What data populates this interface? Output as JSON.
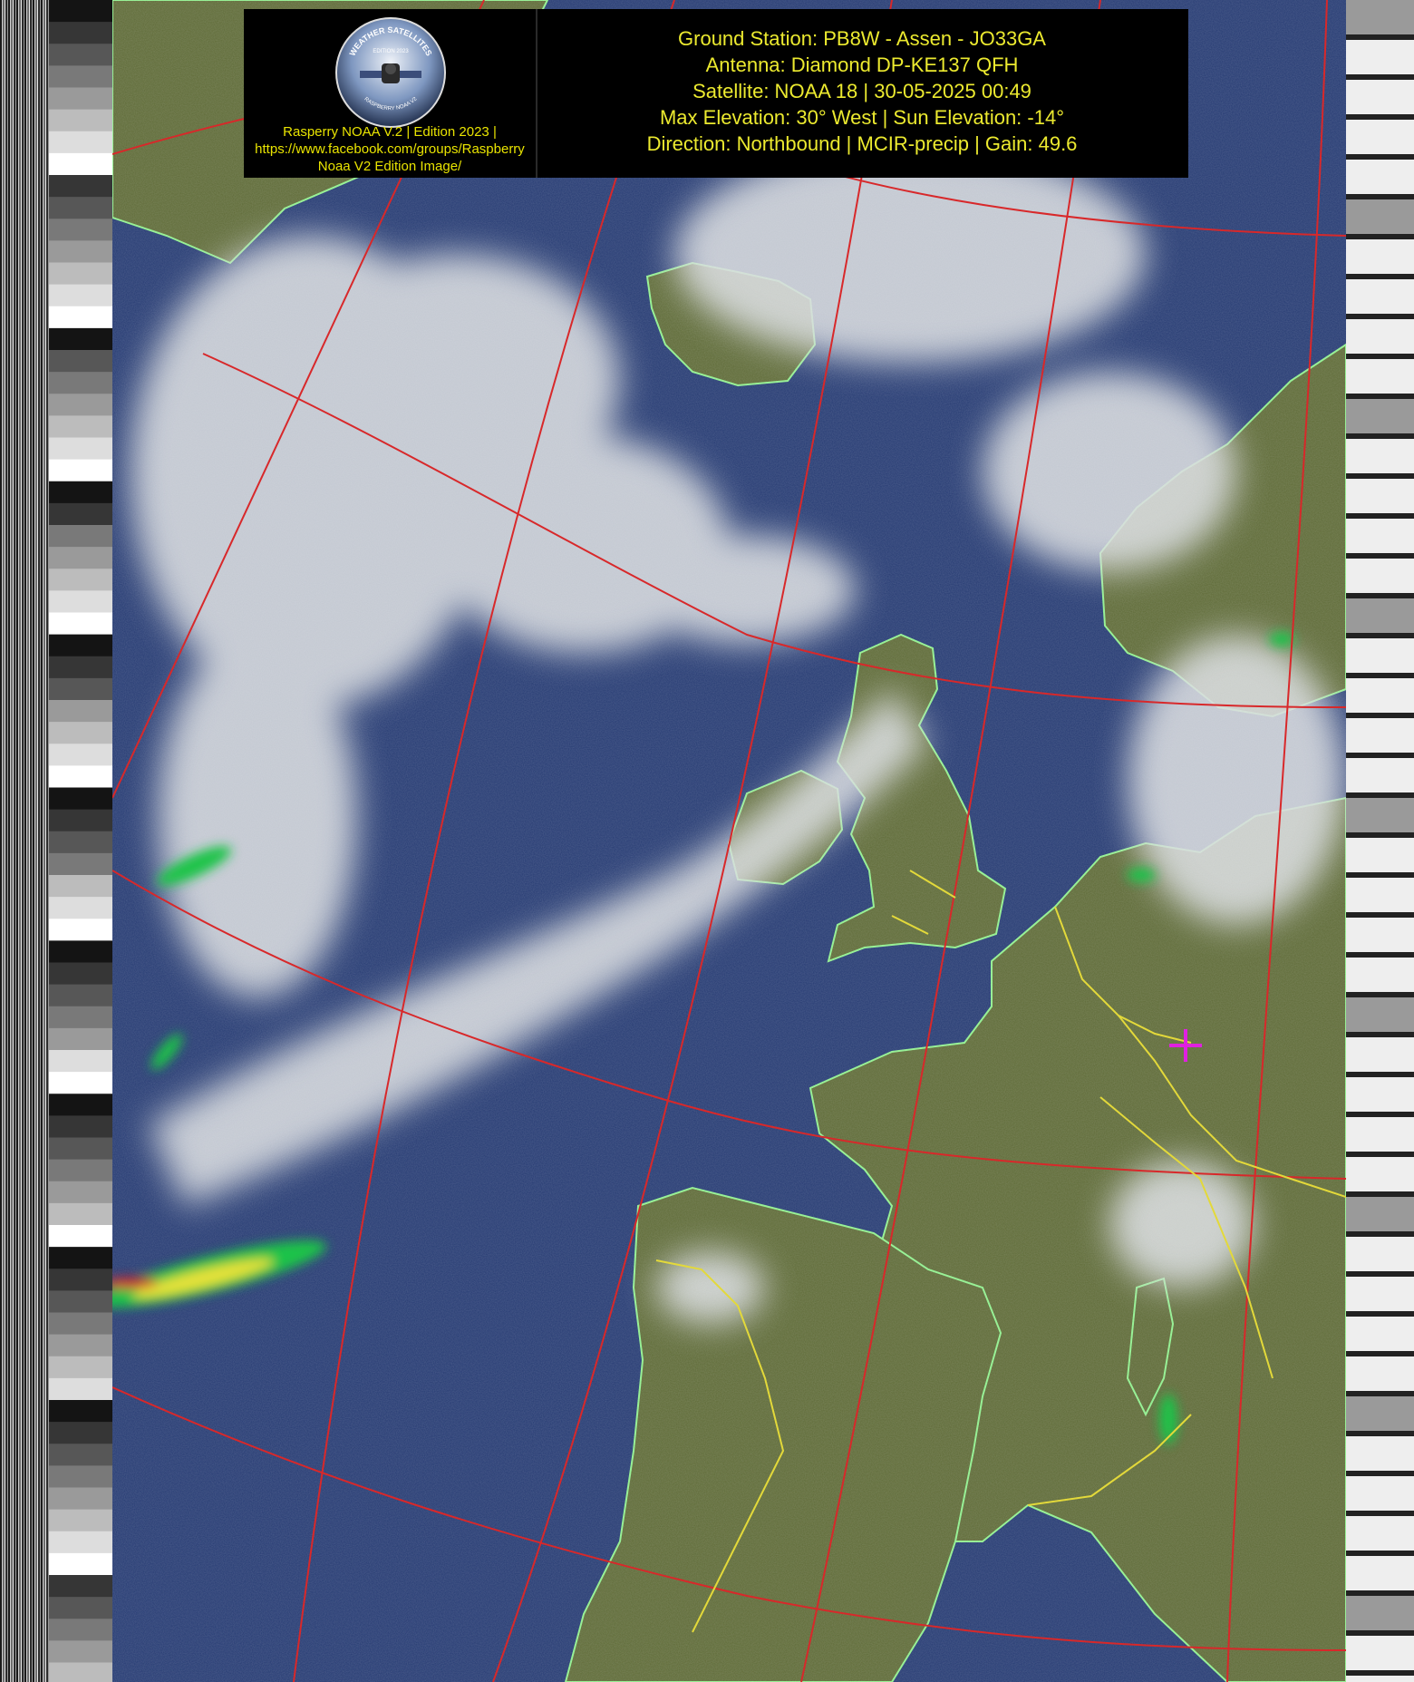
{
  "header": {
    "logo_caption_lines": [
      "Rasperry NOAA V.2 | Edition 2023 |",
      "https://www.facebook.com/groups/Raspberry",
      "Noaa V2 Edition Image/"
    ],
    "info_lines": [
      "Ground Station: PB8W - Assen - JO33GA",
      "Antenna: Diamond DP-KE137 QFH",
      "Satellite: NOAA 18 | 30-05-2025 00:49",
      "Max Elevation: 30° West | Sun Elevation: -14°",
      "Direction: Northbound | MCIR-precip | Gain: 49.6"
    ]
  },
  "logo": {
    "title_text": "WEATHER SATELLITES",
    "edition_text": "EDITION 2023",
    "ring_text": "RASPBERRY NOAA V2"
  },
  "map": {
    "colors": {
      "ocean": "#253a72",
      "cloud": "#d9dcdf",
      "land": "#5e6a36",
      "coastline": "#8ff08c",
      "borders": "#e3d93a",
      "graticule": "#d8282a",
      "precip_green": "#1fc34a",
      "precip_yellow": "#e6e238",
      "precip_red": "#d8282a",
      "marker": "#e020e0"
    },
    "marker_icon": "location-cross-icon"
  }
}
